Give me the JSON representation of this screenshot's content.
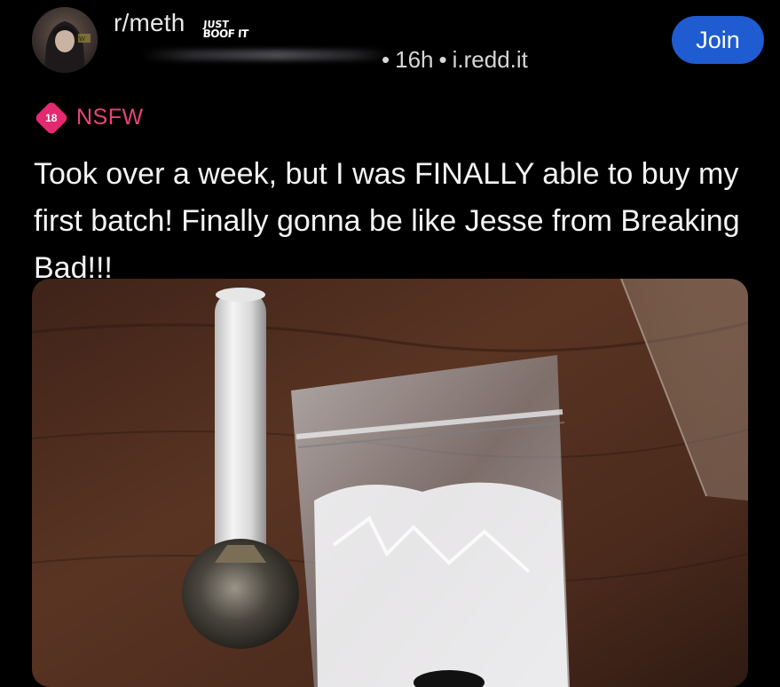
{
  "header": {
    "subreddit": "r/meth",
    "flair_line1": "JUST",
    "flair_line2": "BOOF IT",
    "age": "16h",
    "separator": "•",
    "domain": "i.redd.it",
    "join_label": "Join"
  },
  "post": {
    "nsfw_badge": "18",
    "nsfw_label": "NSFW",
    "title": "Took over a week, but I was FINALLY able to buy my first batch! Finally gonna be like Jesse from Breaking Bad!!!"
  },
  "colors": {
    "background": "#000000",
    "join_button": "#1f5bd1",
    "nsfw": "#e3296f",
    "text": "#f4f4f4"
  }
}
